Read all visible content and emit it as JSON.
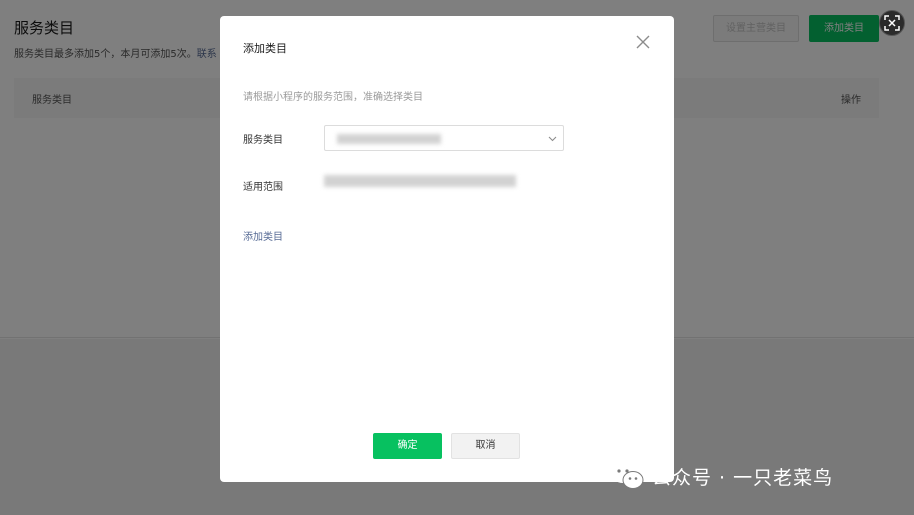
{
  "background": {
    "title": "服务类目",
    "note": "服务类目最多添加5个，本月可添加5次。",
    "note_link": "联系",
    "set_primary_button": "设置主营类目",
    "add_category_button": "添加类目",
    "table": {
      "col_category": "服务类目",
      "col_action": "操作"
    }
  },
  "dialog": {
    "title": "添加类目",
    "hint": "请根据小程序的服务范围，准确选择类目",
    "service_category_label": "服务类目",
    "service_category_value": "",
    "scope_label": "适用范围",
    "add_link": "添加类目",
    "confirm_label": "确定",
    "cancel_label": "取消"
  },
  "watermark": {
    "text": "公众号 · 一只老菜鸟"
  },
  "icons": {
    "close": "close-icon",
    "chevron": "chevron-down-icon",
    "screenshot": "screenshot-scan-icon",
    "wechat": "wechat-logo-icon"
  },
  "colors": {
    "primary": "#07c160",
    "link": "#576b95"
  }
}
